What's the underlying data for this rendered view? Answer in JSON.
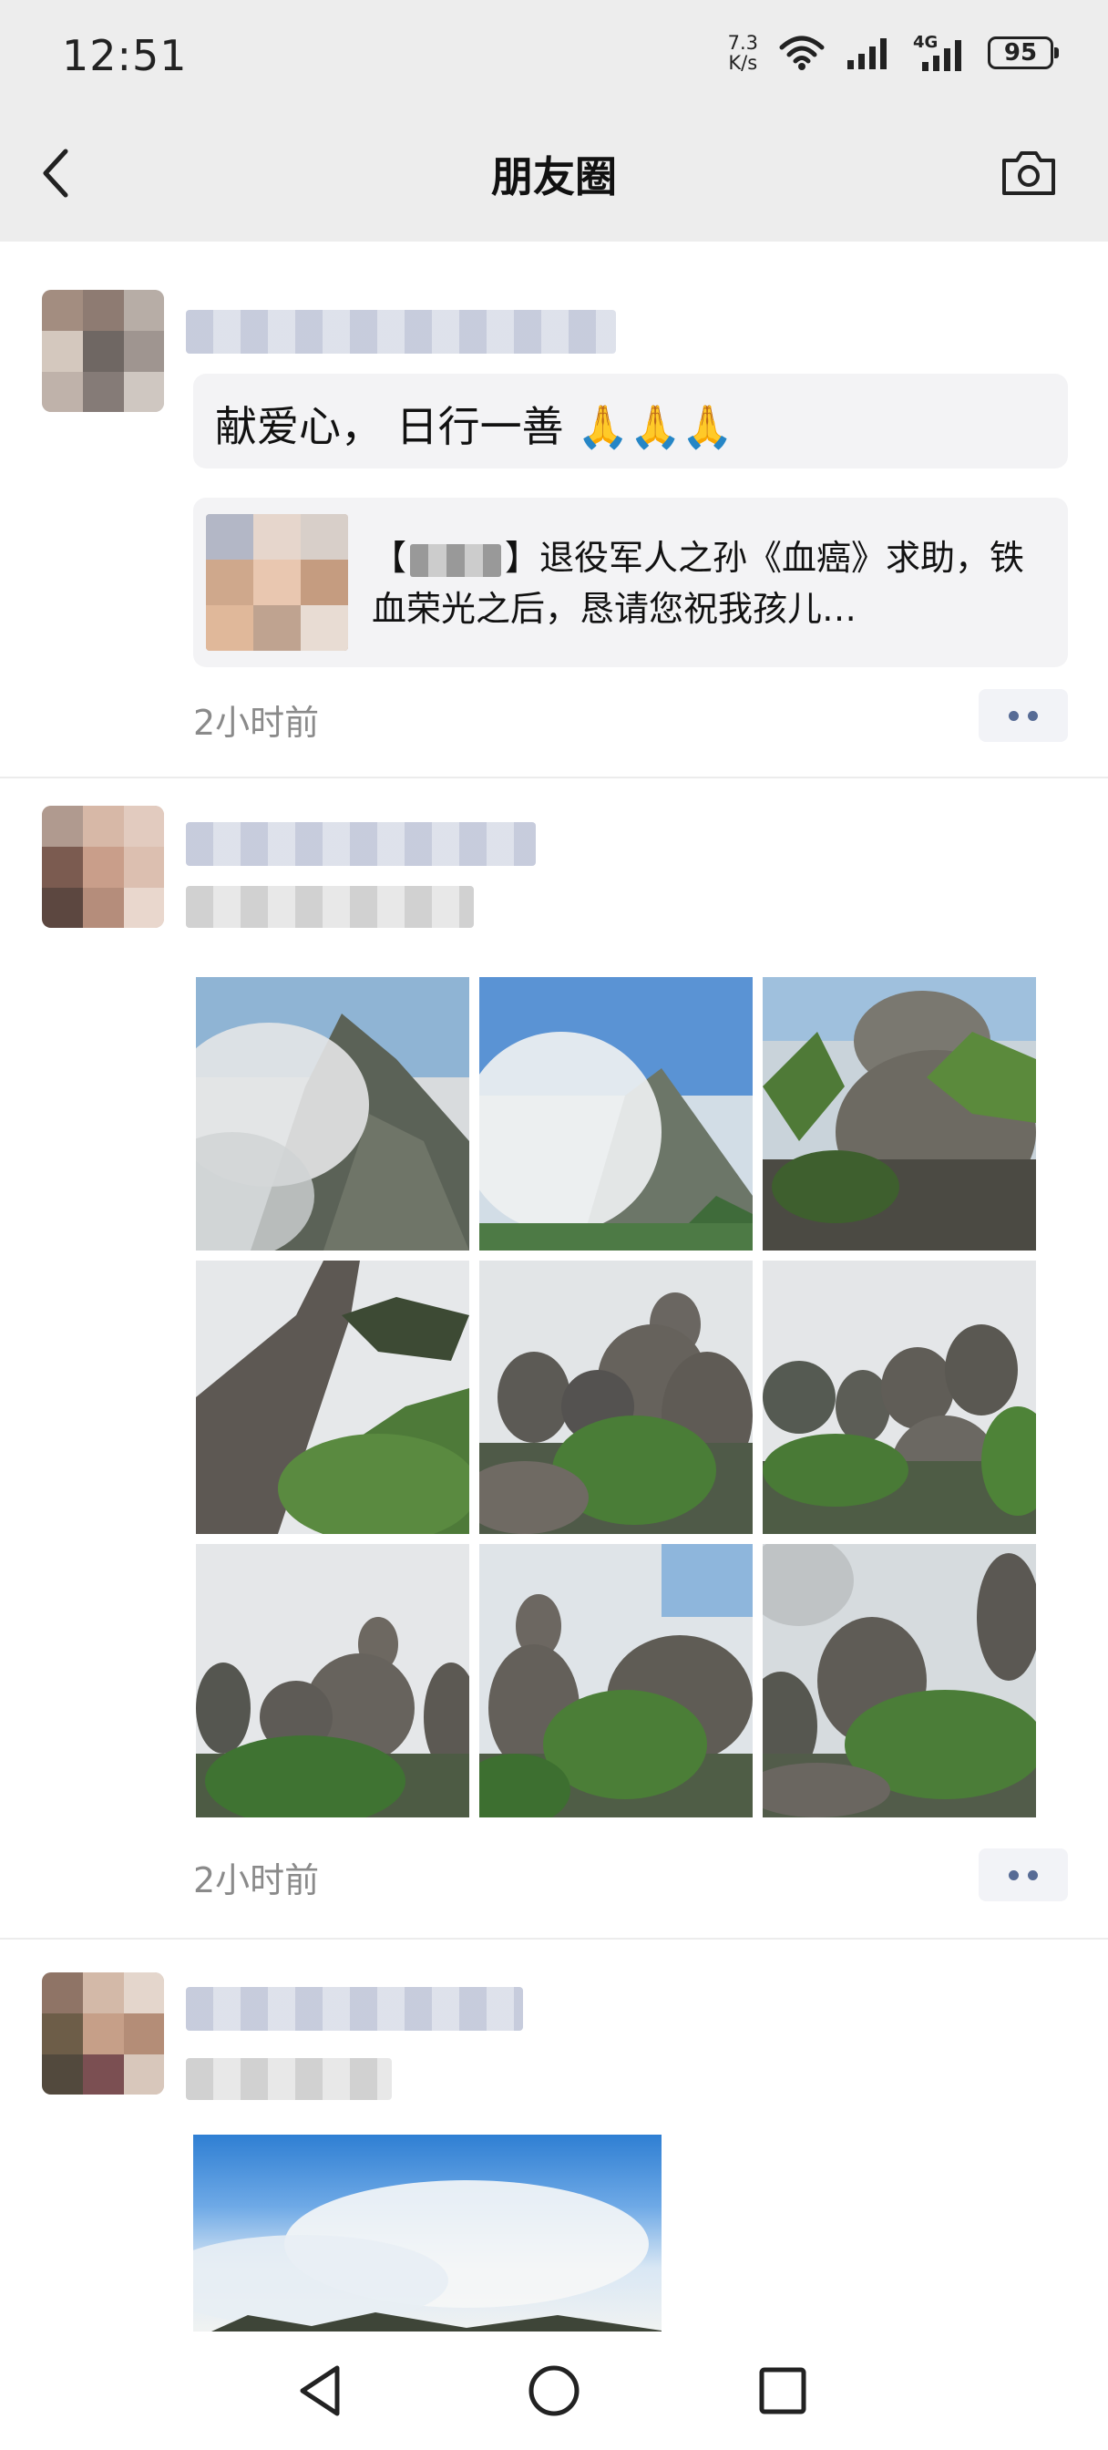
{
  "status": {
    "time": "12:51",
    "net_speed_value": "7.3",
    "net_speed_unit": "K/s",
    "network": "4G",
    "battery": "95"
  },
  "header": {
    "title": "朋友圈",
    "back_icon": "chevron-left-icon",
    "camera_icon": "camera-icon"
  },
  "posts": [
    {
      "text": "献爱心， 日行一善",
      "emoji": "🙏🙏🙏",
      "link": {
        "bracket_left": "【",
        "bracket_right": "】",
        "title": "退役军人之孙《血癌》求助，铁血荣光之后，恳请您祝我孩儿…"
      },
      "time": "2小时前"
    },
    {
      "photo_count": 9,
      "time": "2小时前"
    },
    {
      "photo_count": 1
    }
  ],
  "colors": {
    "accent_blue": "#576b95",
    "header_bg": "#ededed",
    "bubble_bg": "#f3f3f5"
  },
  "navbar": {
    "icons": [
      "back-triangle-icon",
      "home-circle-icon",
      "recents-square-icon"
    ]
  }
}
